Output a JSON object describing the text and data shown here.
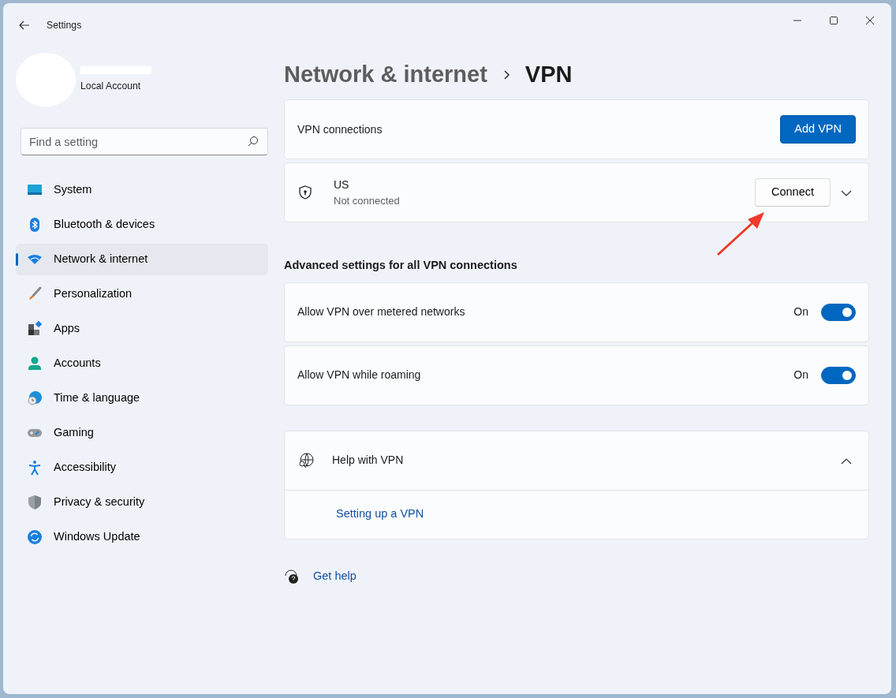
{
  "window": {
    "title": "Settings"
  },
  "account": {
    "type": "Local Account"
  },
  "search": {
    "placeholder": "Find a setting"
  },
  "sidebar": {
    "items": [
      {
        "label": "System",
        "selected": false
      },
      {
        "label": "Bluetooth & devices",
        "selected": false
      },
      {
        "label": "Network & internet",
        "selected": true
      },
      {
        "label": "Personalization",
        "selected": false
      },
      {
        "label": "Apps",
        "selected": false
      },
      {
        "label": "Accounts",
        "selected": false
      },
      {
        "label": "Time & language",
        "selected": false
      },
      {
        "label": "Gaming",
        "selected": false
      },
      {
        "label": "Accessibility",
        "selected": false
      },
      {
        "label": "Privacy & security",
        "selected": false
      },
      {
        "label": "Windows Update",
        "selected": false
      }
    ]
  },
  "breadcrumb": {
    "parent": "Network & internet",
    "current": "VPN"
  },
  "vpn_connections": {
    "label": "VPN connections",
    "button": "Add VPN"
  },
  "connections": [
    {
      "name": "US",
      "status": "Not connected",
      "button": "Connect",
      "expanded": false
    }
  ],
  "advanced": {
    "heading": "Advanced settings for all VPN connections",
    "settings": [
      {
        "label": "Allow VPN over metered networks",
        "state": "On",
        "on": true
      },
      {
        "label": "Allow VPN while roaming",
        "state": "On",
        "on": true
      }
    ]
  },
  "help": {
    "title": "Help with VPN",
    "expanded": true,
    "links": [
      "Setting up a VPN"
    ]
  },
  "get_help": {
    "label": "Get help"
  }
}
